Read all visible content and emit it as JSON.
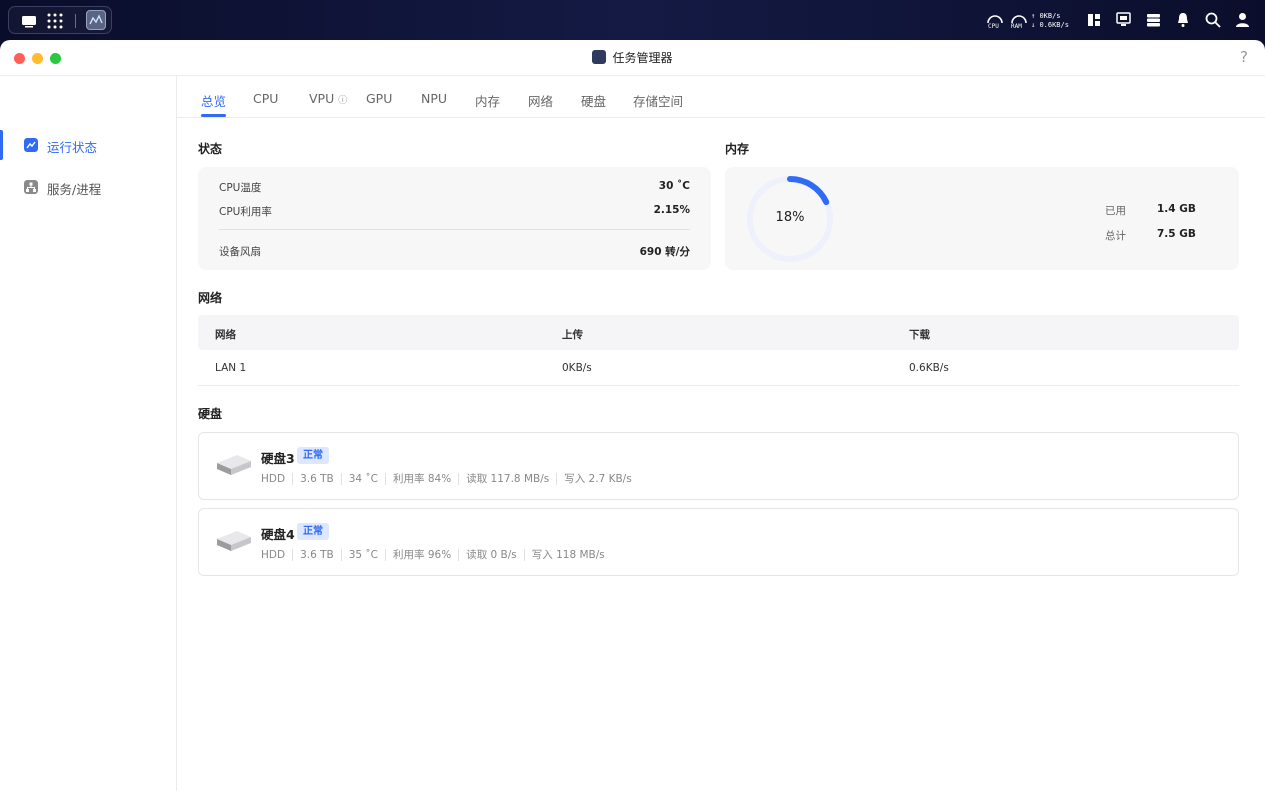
{
  "system_bar": {
    "cpu_label": "CPU",
    "ram_label": "RAM",
    "upload_rate": "0KB/s",
    "download_rate": "0.6KB/s",
    "upload_arrow": "↑",
    "download_arrow": "↓"
  },
  "window": {
    "title": "任务管理器",
    "help": "?"
  },
  "sidebar": {
    "items": [
      {
        "label": "运行状态",
        "icon": "chart-line-icon"
      },
      {
        "label": "服务/进程",
        "icon": "sitemap-icon"
      }
    ]
  },
  "tabs": [
    "总览",
    "CPU",
    "VPU",
    "GPU",
    "NPU",
    "内存",
    "网络",
    "硬盘",
    "存储空间"
  ],
  "status": {
    "title": "状态",
    "cpu_temp_label": "CPU温度",
    "cpu_temp_value": "30 ˚C",
    "cpu_usage_label": "CPU利用率",
    "cpu_usage_value": "2.15%",
    "fan_label": "设备风扇",
    "fan_value": "690 转/分"
  },
  "memory": {
    "title": "内存",
    "percent": 18,
    "percent_label": "18%",
    "used_label": "已用",
    "used_value": "1.4 GB",
    "total_label": "总计",
    "total_value": "7.5 GB"
  },
  "network": {
    "title": "网络",
    "headers": [
      "网络",
      "上传",
      "下载"
    ],
    "rows": [
      [
        "LAN 1",
        "0KB/s",
        "0.6KB/s"
      ]
    ]
  },
  "disks": {
    "title": "硬盘",
    "items": [
      {
        "name": "硬盘3",
        "status": "正常",
        "type": "HDD",
        "capacity": "3.6 TB",
        "temp": "34 ˚C",
        "usage": "利用率 84%",
        "read": "读取 117.8 MB/s",
        "write": "写入 2.7 KB/s"
      },
      {
        "name": "硬盘4",
        "status": "正常",
        "type": "HDD",
        "capacity": "3.6 TB",
        "temp": "35 ˚C",
        "usage": "利用率 96%",
        "read": "读取 0 B/s",
        "write": "写入 118 MB/s"
      }
    ]
  },
  "colors": {
    "accent": "#2f6bf5",
    "ring_track": "#eef1fb"
  }
}
